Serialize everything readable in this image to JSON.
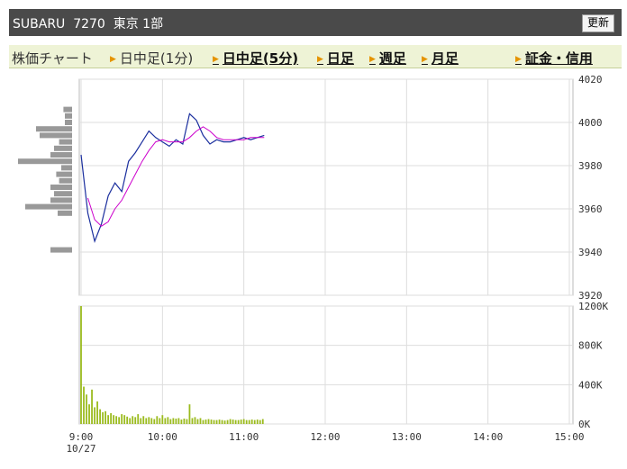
{
  "header": {
    "title": "SUBARU  7270  東京 1部",
    "refresh_label": "更新"
  },
  "tabs": [
    {
      "label": "株価チャート",
      "arrow": false,
      "style": "plain"
    },
    {
      "label": "日中足(1分)",
      "arrow": true,
      "style": "plain"
    },
    {
      "label": "日中足(5分)",
      "arrow": true,
      "style": "link"
    },
    {
      "label": "日足",
      "arrow": true,
      "style": "link"
    },
    {
      "label": "週足",
      "arrow": true,
      "style": "link"
    },
    {
      "label": "月足",
      "arrow": true,
      "style": "link"
    },
    {
      "label": "証金・信用",
      "arrow": true,
      "style": "link"
    }
  ],
  "colors": {
    "price_line": "#1b2f9e",
    "moving_average": "#cc00cc",
    "volume_bars": "#9bbb1e",
    "price_profile": "#999999",
    "grid": "#dddddd"
  },
  "chart_data": [
    {
      "type": "line",
      "name": "price",
      "x_ticks": [
        "9:00",
        "10:00",
        "11:00",
        "12:00",
        "13:00",
        "14:00",
        "15:00"
      ],
      "x_date": "10/27",
      "x_range": [
        "9:00",
        "15:00"
      ],
      "y_ticks": [
        4020,
        4000,
        3980,
        3960,
        3940,
        3920
      ],
      "ylim": [
        3920,
        4020
      ],
      "y_axis_position": "right",
      "grid": true,
      "series": [
        {
          "role": "price",
          "times": [
            "9:00",
            "9:05",
            "9:10",
            "9:15",
            "9:20",
            "9:25",
            "9:30",
            "9:35",
            "9:40",
            "9:45",
            "9:50",
            "9:55",
            "10:00",
            "10:05",
            "10:10",
            "10:15",
            "10:20",
            "10:25",
            "10:30",
            "10:35",
            "10:40",
            "10:45",
            "10:50",
            "10:55",
            "11:00",
            "11:05",
            "11:10",
            "11:15"
          ],
          "values": [
            3985,
            3958,
            3945,
            3953,
            3966,
            3972,
            3968,
            3982,
            3986,
            3991,
            3996,
            3993,
            3991,
            3989,
            3992,
            3990,
            4004,
            4001,
            3994,
            3990,
            3992,
            3991,
            3991,
            3992,
            3993,
            3992,
            3993,
            3994
          ]
        },
        {
          "role": "moving_average",
          "times": [
            "9:05",
            "9:10",
            "9:15",
            "9:20",
            "9:25",
            "9:30",
            "9:35",
            "9:40",
            "9:45",
            "9:50",
            "9:55",
            "10:00",
            "10:05",
            "10:10",
            "10:15",
            "10:20",
            "10:25",
            "10:30",
            "10:35",
            "10:40",
            "10:45",
            "10:50",
            "10:55",
            "11:00",
            "11:05",
            "11:10",
            "11:15"
          ],
          "values": [
            3965,
            3955,
            3952,
            3954,
            3960,
            3964,
            3970,
            3976,
            3982,
            3987,
            3991,
            3992,
            3991,
            3991,
            3991,
            3993,
            3996,
            3998,
            3996,
            3993,
            3992,
            3992,
            3992,
            3992,
            3993,
            3993,
            3993
          ]
        }
      ],
      "price_profile": {
        "prices": [
          4006,
          4003,
          4000,
          3997,
          3994,
          3991,
          3988,
          3985,
          3982,
          3979,
          3976,
          3973,
          3970,
          3967,
          3964,
          3961,
          3958,
          3941
        ],
        "volumes": [
          0.12,
          0.1,
          0.1,
          0.5,
          0.45,
          0.18,
          0.25,
          0.3,
          0.75,
          0.15,
          0.22,
          0.18,
          0.3,
          0.25,
          0.3,
          0.65,
          0.2,
          0.3
        ]
      }
    },
    {
      "type": "bar",
      "name": "volume",
      "y_ticks": [
        "1200K",
        "800K",
        "400K",
        "0K"
      ],
      "ylim": [
        0,
        1200
      ],
      "unit": "K",
      "times": [
        "9:00",
        "9:02",
        "9:04",
        "9:06",
        "9:08",
        "9:10",
        "9:12",
        "9:14",
        "9:16",
        "9:18",
        "9:20",
        "9:22",
        "9:24",
        "9:26",
        "9:28",
        "9:30",
        "9:32",
        "9:34",
        "9:36",
        "9:38",
        "9:40",
        "9:42",
        "9:44",
        "9:46",
        "9:48",
        "9:50",
        "9:52",
        "9:54",
        "9:56",
        "9:58",
        "10:00",
        "10:02",
        "10:04",
        "10:06",
        "10:08",
        "10:10",
        "10:12",
        "10:14",
        "10:16",
        "10:18",
        "10:20",
        "10:22",
        "10:24",
        "10:26",
        "10:28",
        "10:30",
        "10:32",
        "10:34",
        "10:36",
        "10:38",
        "10:40",
        "10:42",
        "10:44",
        "10:46",
        "10:48",
        "10:50",
        "10:52",
        "10:54",
        "10:56",
        "10:58",
        "11:00",
        "11:02",
        "11:04",
        "11:06",
        "11:08",
        "11:10",
        "11:12",
        "11:14"
      ],
      "values": [
        1200,
        380,
        300,
        200,
        350,
        170,
        230,
        150,
        120,
        130,
        90,
        110,
        90,
        80,
        70,
        100,
        90,
        75,
        60,
        80,
        70,
        100,
        60,
        80,
        60,
        70,
        60,
        50,
        80,
        60,
        90,
        60,
        70,
        50,
        60,
        55,
        60,
        45,
        55,
        50,
        200,
        60,
        70,
        50,
        60,
        40,
        45,
        50,
        45,
        40,
        40,
        45,
        40,
        35,
        40,
        50,
        45,
        40,
        40,
        45,
        50,
        40,
        40,
        45,
        40,
        45,
        40,
        50
      ]
    }
  ]
}
